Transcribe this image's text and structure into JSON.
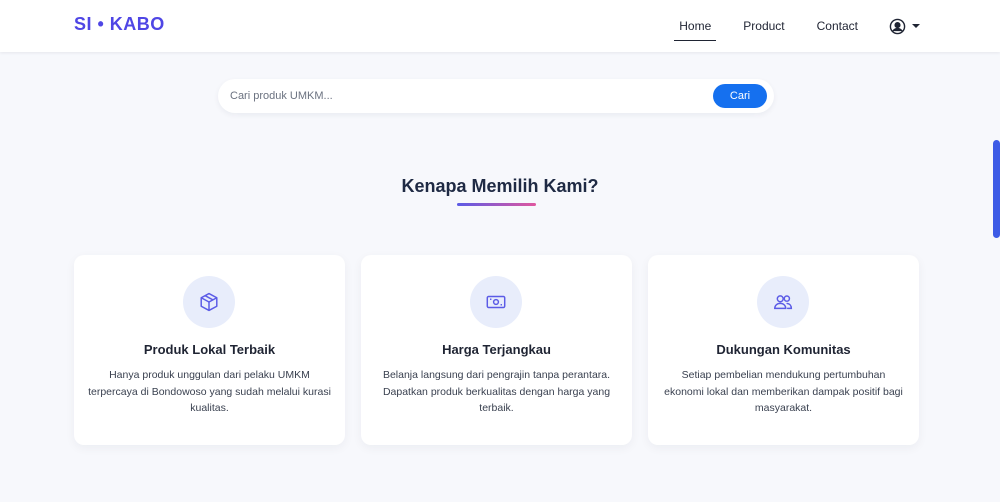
{
  "brand": "SI • KABO",
  "nav": {
    "links": [
      "Home",
      "Product",
      "Contact"
    ],
    "active": "Home"
  },
  "search": {
    "placeholder": "Cari produk UMKM...",
    "value": "",
    "button_label": "Cari"
  },
  "section": {
    "title": "Kenapa Memilih Kami?"
  },
  "cards": [
    {
      "icon": "box-icon",
      "title": "Produk Lokal Terbaik",
      "description": "Hanya produk unggulan dari pelaku UMKM terpercaya di Bondowoso yang sudah melalui kurasi kualitas."
    },
    {
      "icon": "money-icon",
      "title": "Harga Terjangkau",
      "description": "Belanja langsung dari pengrajin tanpa perantara. Dapatkan produk berkualitas dengan harga yang terbaik."
    },
    {
      "icon": "users-icon",
      "title": "Dukungan Komunitas",
      "description": "Setiap pembelian mendukung pertumbuhan ekonomi lokal dan memberikan dampak positif bagi masyarakat."
    }
  ],
  "colors": {
    "brand": "#4f46e5",
    "accent": "#1570ef",
    "icon": "#5b5be6",
    "underline_start": "#5b5be6",
    "underline_end": "#e0579f"
  }
}
